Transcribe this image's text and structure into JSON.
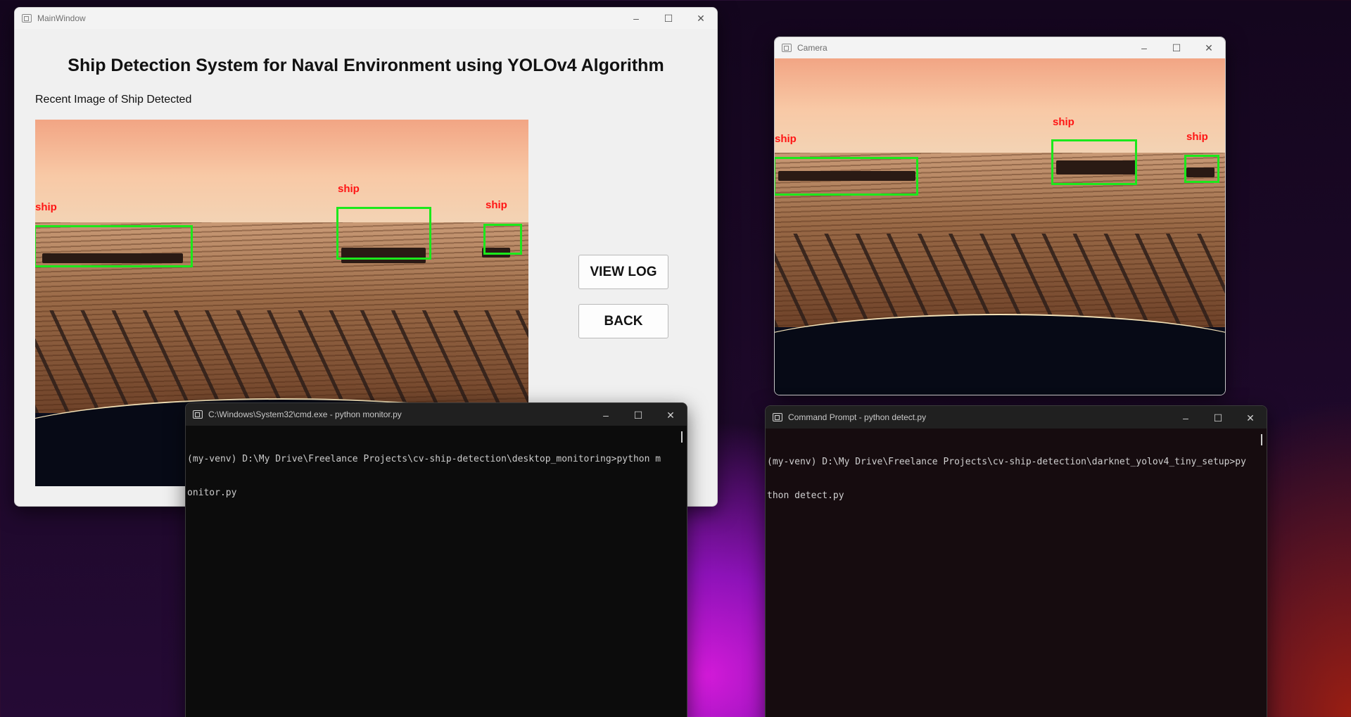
{
  "main_window": {
    "title": "MainWindow",
    "heading": "Ship Detection System for Naval Environment using YOLOv4 Algorithm",
    "image_label": "Recent Image of Ship Detected",
    "detections": [
      "ship",
      "ship",
      "ship"
    ],
    "buttons": {
      "view_log": "VIEW LOG",
      "back": "BACK"
    }
  },
  "camera_window": {
    "title": "Camera",
    "detections": [
      "ship",
      "ship",
      "ship"
    ]
  },
  "terminal_monitor": {
    "title": "C:\\Windows\\System32\\cmd.exe - python  monitor.py",
    "line1": "(my-venv) D:\\My Drive\\Freelance Projects\\cv-ship-detection\\desktop_monitoring>python m",
    "line2": "onitor.py"
  },
  "terminal_detect": {
    "title": "Command Prompt - python  detect.py",
    "line1": "(my-venv) D:\\My Drive\\Freelance Projects\\cv-ship-detection\\darknet_yolov4_tiny_setup>py",
    "line2": "thon detect.py"
  },
  "window_controls": {
    "minimize": "–",
    "maximize": "☐",
    "close": "✕"
  },
  "colors": {
    "bbox": "#1ce81c",
    "label": "#ff1414",
    "terminal_bg": "#0c0c0c"
  }
}
